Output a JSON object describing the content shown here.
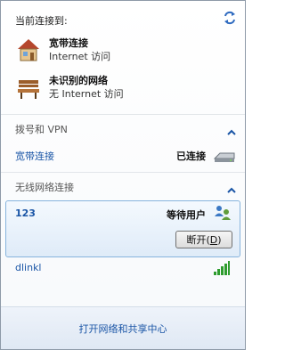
{
  "current": {
    "title": "当前连接到:",
    "connections": [
      {
        "name": "宽带连接",
        "status": "Internet 访问",
        "icon": "house-icon"
      },
      {
        "name": "未识别的网络",
        "status": "无 Internet 访问",
        "icon": "bench-icon"
      }
    ]
  },
  "dialup": {
    "header": "拨号和 VPN",
    "items": [
      {
        "name": "宽带连接",
        "status": "已连接",
        "icon": "modem-icon"
      }
    ]
  },
  "wireless": {
    "header": "无线网络连接",
    "selected": {
      "ssid": "123",
      "status": "等待用户",
      "disconnect_label": "断开(",
      "disconnect_key": "D",
      "disconnect_suffix": ")"
    },
    "items": [
      {
        "ssid": "dlinkl",
        "icon": "signal-strength-icon"
      }
    ]
  },
  "footer": {
    "link": "打开网络和共享中心"
  }
}
